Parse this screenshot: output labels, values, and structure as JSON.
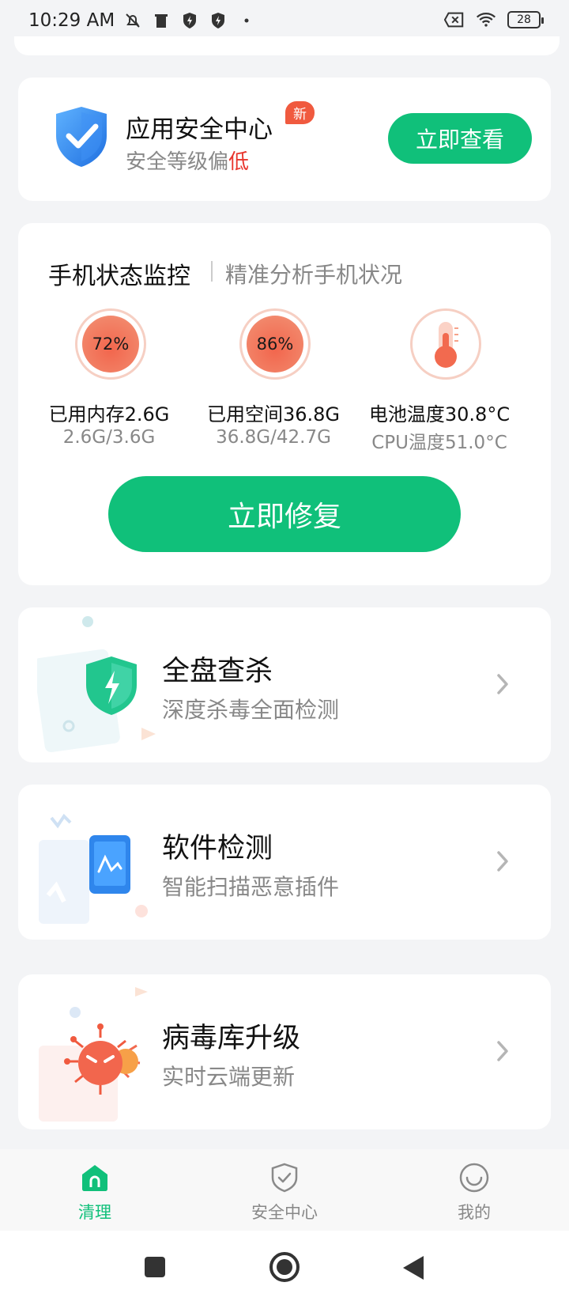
{
  "status_bar": {
    "time": "10:29 AM",
    "battery": "28",
    "icons": [
      "mute-icon",
      "trash-icon",
      "shield-bolt-icon",
      "shield-bolt-icon",
      "dot-icon",
      "sim-x-icon",
      "wifi-icon",
      "battery-icon"
    ]
  },
  "security_card": {
    "title": "应用安全中心",
    "badge": "新",
    "subtitle_prefix": "安全等级偏",
    "subtitle_level": "低",
    "button": "立即查看"
  },
  "monitor_card": {
    "title": "手机状态监控",
    "subtitle": "精准分析手机状况",
    "metrics": [
      {
        "gauge_text": "72%",
        "label": "已用内存2.6G",
        "sub": "2.6G/3.6G",
        "icon": "memory-gauge"
      },
      {
        "gauge_text": "86%",
        "label": "已用空间36.8G",
        "sub": "36.8G/42.7G",
        "icon": "storage-gauge"
      },
      {
        "gauge_text": "",
        "label": "电池温度30.8°C",
        "sub": "CPU温度51.0°C",
        "icon": "thermometer-icon"
      }
    ],
    "button": "立即修复"
  },
  "features": [
    {
      "title": "全盘查杀",
      "subtitle": "深度杀毒全面检测",
      "icon": "shield-lightning-icon"
    },
    {
      "title": "软件检测",
      "subtitle": "智能扫描恶意插件",
      "icon": "phone-scan-icon"
    },
    {
      "title": "病毒库升级",
      "subtitle": "实时云端更新",
      "icon": "virus-icon"
    }
  ],
  "bottom_nav": {
    "items": [
      {
        "label": "清理",
        "icon": "home-icon",
        "active": true
      },
      {
        "label": "安全中心",
        "icon": "shield-check-icon",
        "active": false
      },
      {
        "label": "我的",
        "icon": "smile-icon",
        "active": false
      }
    ]
  },
  "colors": {
    "accent": "#10c07a",
    "danger": "#e8352d",
    "badge": "#f05a3f"
  }
}
